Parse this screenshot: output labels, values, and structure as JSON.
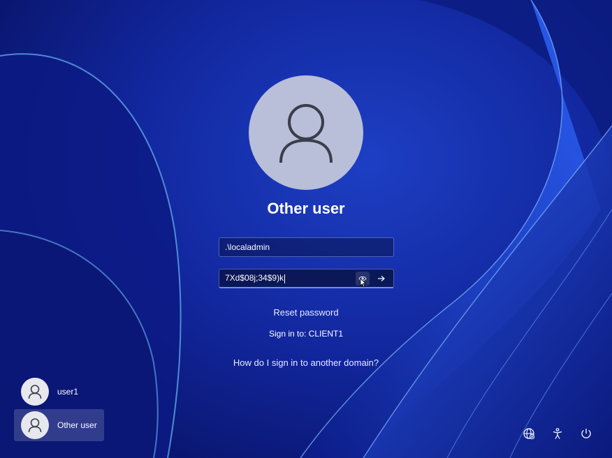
{
  "login": {
    "title": "Other user",
    "username_value": ".\\localadmin",
    "password_value": "7Xd$08j;34$9)k",
    "reset_password": "Reset password",
    "sign_in_to": "Sign in to: CLIENT1",
    "domain_help": "How do I sign in to another domain?"
  },
  "user_switcher": {
    "users": [
      {
        "label": "user1",
        "icon": "person-icon"
      },
      {
        "label": "Other user",
        "icon": "person-icon",
        "selected": true
      }
    ]
  },
  "corner_controls": [
    {
      "icon": "network-icon"
    },
    {
      "icon": "accessibility-icon"
    },
    {
      "icon": "power-icon"
    }
  ],
  "colors": {
    "background": "#12279e",
    "avatar": "#b9bed9",
    "accent": "#6f8dff"
  }
}
